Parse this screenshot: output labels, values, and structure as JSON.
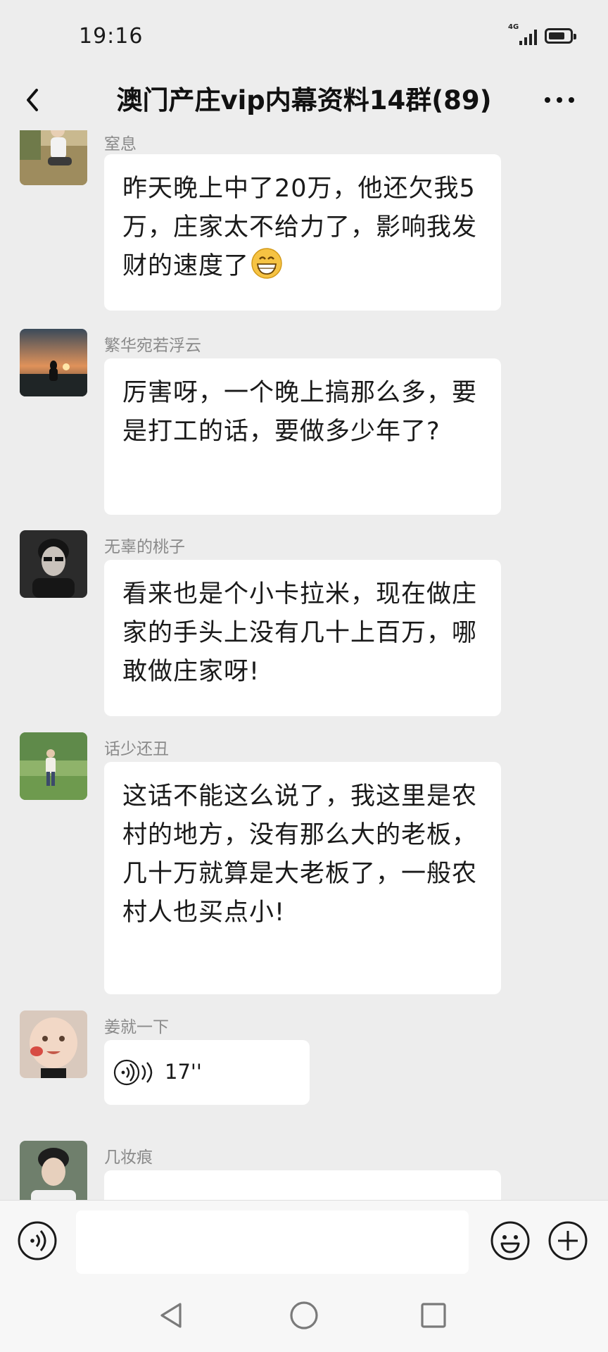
{
  "status": {
    "time": "19:16",
    "network": "4G",
    "battery_level": 0.8
  },
  "header": {
    "title": "澳门产庄vip内幕资料14群(89)",
    "back_icon": "chevron-left-icon",
    "more_icon": "more-dots-icon"
  },
  "messages": [
    {
      "sender": "窒息",
      "type": "text",
      "text": "昨天晚上中了20万，他还欠我5万，庄家太不给力了，影响我发财的速度了",
      "emoji": "grinning-emoji"
    },
    {
      "sender": "繁华宛若浮云",
      "type": "text",
      "text": "厉害呀，一个晚上搞那么多，要是打工的话，要做多少年了?"
    },
    {
      "sender": "无辜的桃子",
      "type": "text",
      "text": "看来也是个小卡拉米，现在做庄家的手头上没有几十上百万，哪敢做庄家呀!"
    },
    {
      "sender": "话少还丑",
      "type": "text",
      "text": "这话不能这么说了，我这里是农村的地方，没有那么大的老板，几十万就算是大老板了，一般农村人也买点小!"
    },
    {
      "sender": "姜就一下",
      "type": "voice",
      "duration": "17''"
    },
    {
      "sender": "几妆痕",
      "type": "text",
      "text": ""
    }
  ],
  "input_bar": {
    "voice_icon": "voice-mode-icon",
    "emoji_icon": "emoji-icon",
    "plus_icon": "plus-icon",
    "input_value": ""
  },
  "system_nav": {
    "back": "triangle-back-icon",
    "home": "circle-home-icon",
    "recents": "square-recents-icon"
  },
  "colors": {
    "background": "#ededed",
    "bubble": "#ffffff",
    "sender_name": "#8a8a8a",
    "text": "#1a1a1a"
  }
}
